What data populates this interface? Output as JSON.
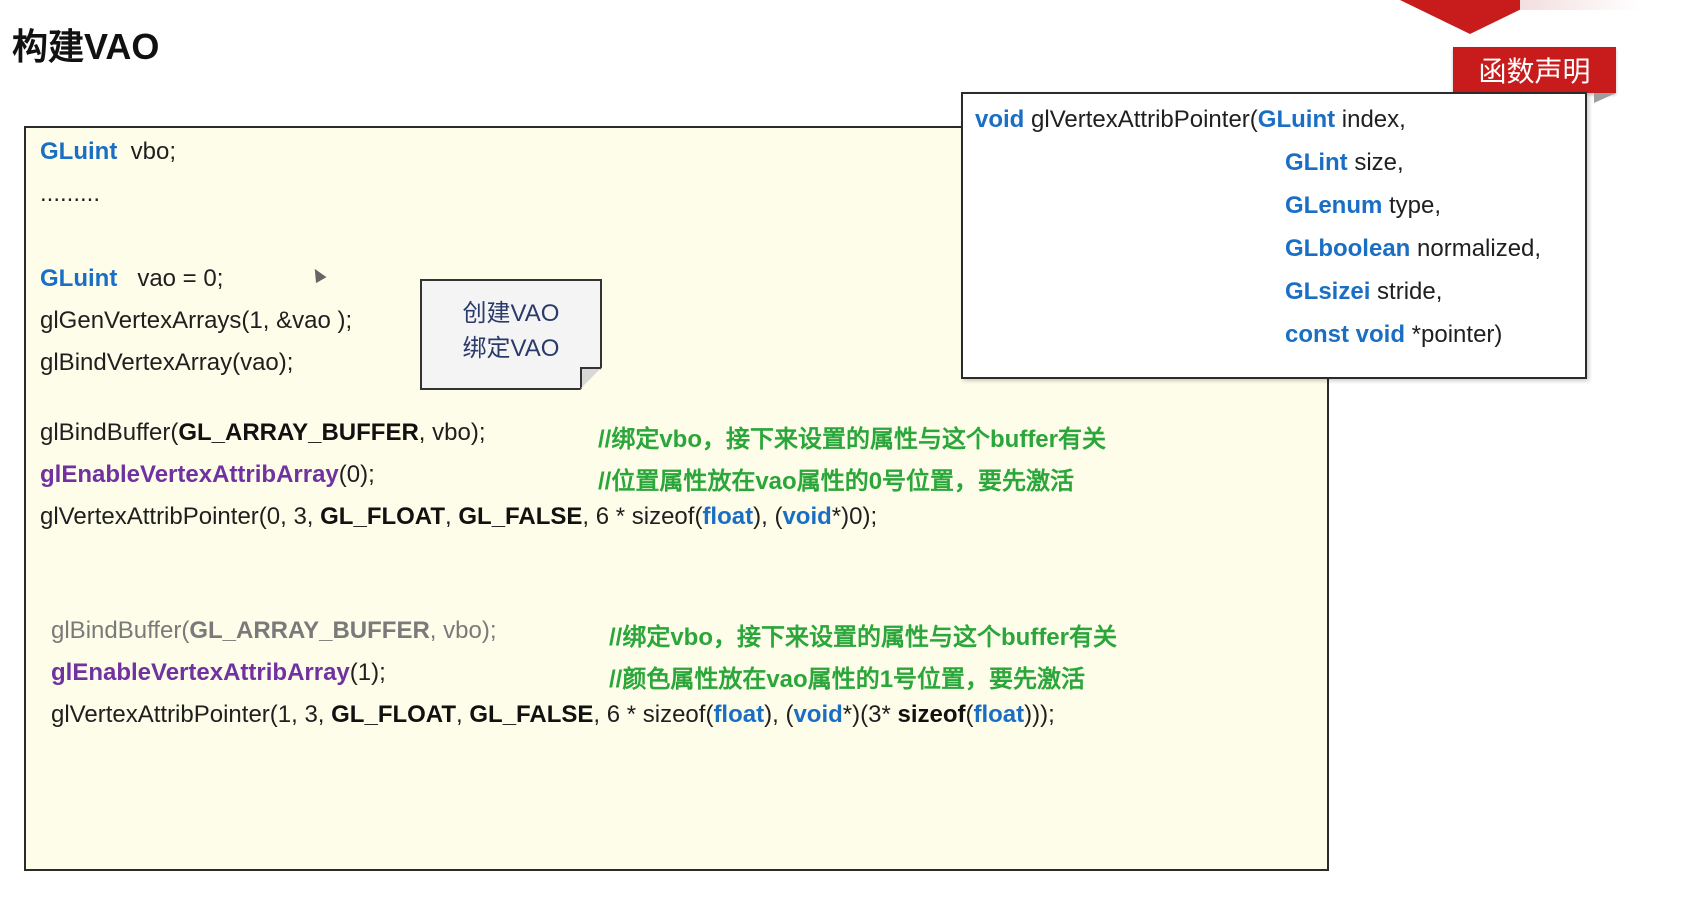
{
  "slide": {
    "title": "构建VAO",
    "declaration_tag": "函数声明"
  },
  "note": {
    "line1": "创建VAO",
    "line2": "绑定VAO"
  },
  "code": {
    "l1_type": "GLuint",
    "l1_rest": "  vbo;",
    "l2": ".........",
    "l3_type": "GLuint",
    "l3_rest": "   vao = 0;",
    "l4": "glGenVertexArrays(1, &vao );",
    "l5": "glBindVertexArray(vao);",
    "l6_fn": "glBindBuffer(",
    "l6_const": "GL_ARRAY_BUFFER",
    "l6_rest": ", vbo);",
    "l6_comment": "//绑定vbo，接下来设置的属性与这个buffer有关",
    "l7_fn": "glEnableVertexAttribArray",
    "l7_rest": "(0);",
    "l7_comment": "//位置属性放在vao属性的0号位置，要先激活",
    "l8_a": "glVertexAttribPointer(0, 3, ",
    "l8_float_const": "GL_FLOAT",
    "l8_sep": ", ",
    "l8_false_const": "GL_FALSE",
    "l8_b": ", 6 * sizeof(",
    "l8_float_kw": "float",
    "l8_c": "), (",
    "l8_void_kw": "void",
    "l8_d": "*)0);",
    "l9_fn": "glBindBuffer(",
    "l9_const": "GL_ARRAY_BUFFER",
    "l9_rest": ", vbo);",
    "l9_comment": "//绑定vbo，接下来设置的属性与这个buffer有关",
    "l10_fn": "glEnableVertexAttribArray",
    "l10_rest": "(1);",
    "l10_comment": "//颜色属性放在vao属性的1号位置，要先激活",
    "l11_a": "glVertexAttribPointer(1, 3, ",
    "l11_float_const": "GL_FLOAT",
    "l11_sep": ", ",
    "l11_false_const": "GL_FALSE",
    "l11_b": ", 6 * sizeof(",
    "l11_float_kw": "float",
    "l11_c": "), (",
    "l11_void_kw": "void",
    "l11_d": "*)(3* ",
    "l11_sizeof": "sizeof",
    "l11_e": "(",
    "l11_float_kw2": "float",
    "l11_f": ")));"
  },
  "declaration": {
    "d1_kw": "void",
    "d1_rest": " glVertexAttribPointer(",
    "d1_type": "GLuint",
    "d1_param": " index,",
    "d2_type": "GLint",
    "d2_param": " size,",
    "d3_type": "GLenum",
    "d3_param": " type,",
    "d4_type": "GLboolean",
    "d4_param": " normalized,",
    "d5_type": "GLsizei",
    "d5_param": " stride,",
    "d6_type": "const void",
    "d6_param": " *pointer)"
  }
}
